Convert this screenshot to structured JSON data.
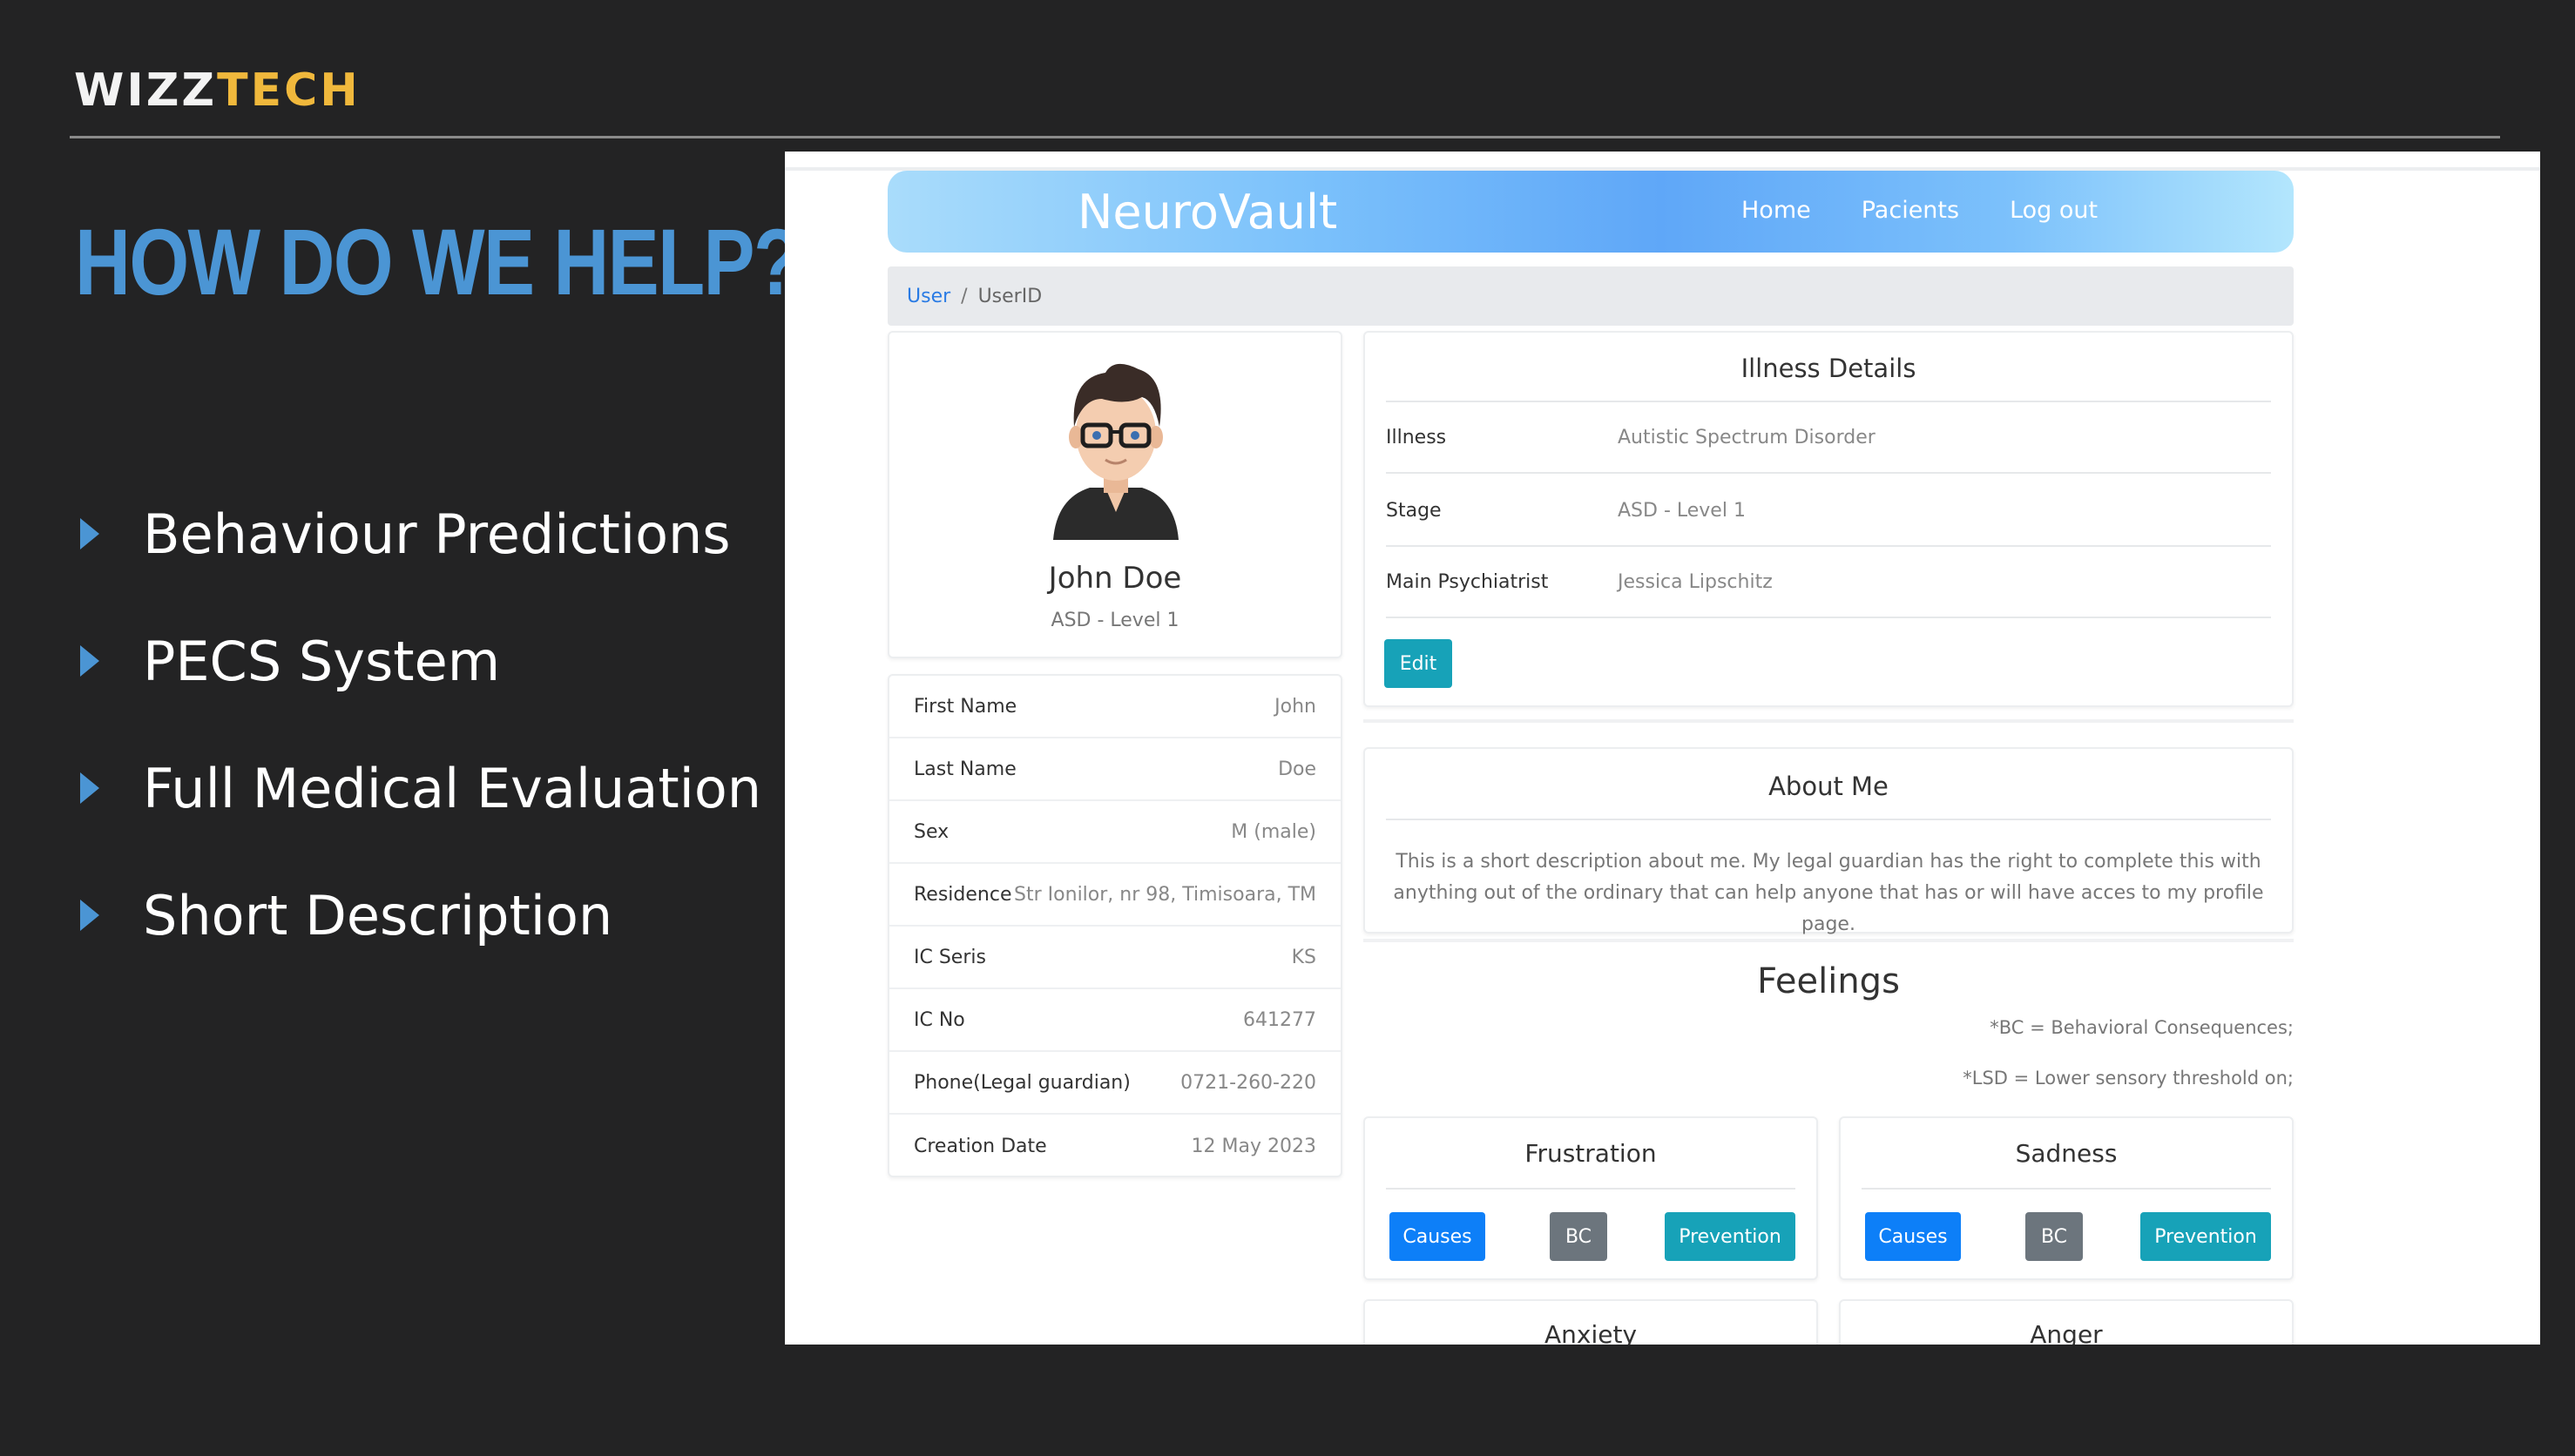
{
  "slide": {
    "brand_main": "WIZZ",
    "brand_accent": "TECH",
    "headline": "HOW DO WE HELP?",
    "bullets": [
      "Behaviour Predictions",
      "PECS System",
      "Full Medical Evaluation",
      "Short Description"
    ],
    "colors": {
      "background": "#232324",
      "headline": "#4b95d4",
      "brand_accent": "#f0b83c"
    }
  },
  "app": {
    "title": "NeuroVault",
    "nav": [
      "Home",
      "Pacients",
      "Log out"
    ],
    "breadcrumb": {
      "link": "User",
      "separator": "/",
      "current": "UserID"
    },
    "profile": {
      "name": "John Doe",
      "level": "ASD - Level 1",
      "avatar_icon": "person-avatar-icon"
    },
    "info_rows": [
      {
        "label": "First Name",
        "value": "John"
      },
      {
        "label": "Last Name",
        "value": "Doe"
      },
      {
        "label": "Sex",
        "value": "M (male)"
      },
      {
        "label": "Residence",
        "value": "Str Ionilor, nr 98, Timisoara, TM"
      },
      {
        "label": "IC Seris",
        "value": "KS"
      },
      {
        "label": "IC No",
        "value": "641277"
      },
      {
        "label": "Phone(Legal guardian)",
        "value": "0721-260-220"
      },
      {
        "label": "Creation Date",
        "value": "12 May 2023"
      }
    ],
    "illness": {
      "title": "Illness Details",
      "rows": [
        {
          "label": "Illness",
          "value": "Autistic Spectrum Disorder"
        },
        {
          "label": "Stage",
          "value": "ASD - Level 1"
        },
        {
          "label": "Main Psychiatrist",
          "value": "Jessica Lipschitz"
        }
      ],
      "edit_label": "Edit"
    },
    "about": {
      "title": "About Me",
      "text": "This is a short description about me. My legal guardian has the right to complete this with anything out of the ordinary that can help anyone that has or will have acces to my profile page."
    },
    "feelings": {
      "title": "Feelings",
      "note_bc": "*BC = Behavioral Consequences;",
      "note_lsd": "*LSD = Lower sensory threshold on;",
      "cards": [
        {
          "name": "Frustration",
          "buttons": [
            "Causes",
            "BC",
            "Prevention"
          ]
        },
        {
          "name": "Sadness",
          "buttons": [
            "Causes",
            "BC",
            "Prevention"
          ]
        },
        {
          "name": "Anxiety"
        },
        {
          "name": "Anger"
        }
      ]
    },
    "colors": {
      "primary": "#0d7ff8",
      "teal": "#17a2b8",
      "secondary": "#6c757d"
    }
  }
}
